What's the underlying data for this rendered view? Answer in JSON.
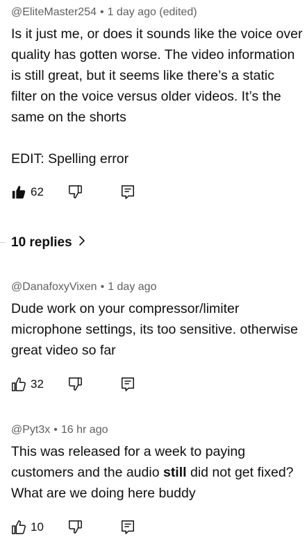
{
  "comments": [
    {
      "handle": "@EliteMaster254",
      "time": "1 day ago (edited)",
      "body": [
        "Is it just me, or does it sounds like the voice over quality has gotten worse. The video information is still great, but it seems like there’s a static filter on the voice versus older videos. It’s the same on the shorts",
        "EDIT: Spelling error"
      ],
      "likes": "62",
      "liked": true
    },
    {
      "handle": "@DanafoxyVixen",
      "time": "1 day ago",
      "body": [
        "Dude work on your compressor/limiter microphone settings, its too sensitive. otherwise great video so far"
      ],
      "likes": "32",
      "liked": false
    },
    {
      "handle": "@Pyt3x",
      "time": "16 hr ago",
      "body_parts": [
        "This was released for a week to paying customers and the audio ",
        "still",
        " did not get fixed? What are we doing here buddy"
      ],
      "likes": "10",
      "liked": false
    }
  ],
  "separator": "•",
  "replies_label": "10 replies",
  "icons": {
    "like": "thumbs-up-icon",
    "dislike": "thumbs-down-icon",
    "reply": "reply-icon",
    "chevron": "chevron-right-icon"
  },
  "colors": {
    "text": "#0f0f0f",
    "meta": "#606060"
  }
}
